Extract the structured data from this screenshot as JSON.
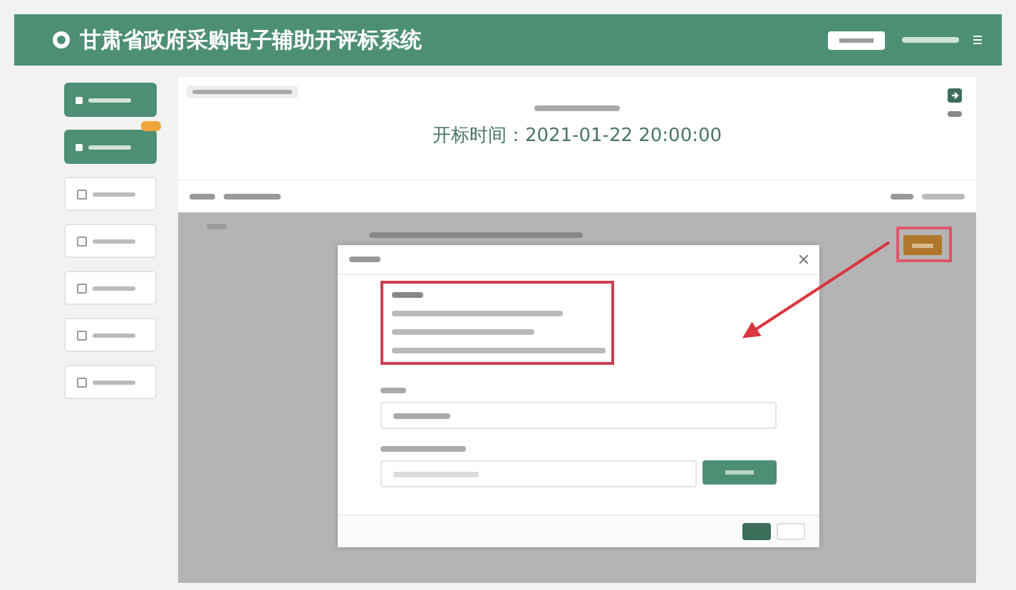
{
  "header": {
    "title": "甘肃省政府采购电子辅助开评标系统"
  },
  "sidebar": {
    "items": [
      {
        "kind": "primary",
        "badge": false
      },
      {
        "kind": "primary",
        "badge": true
      },
      {
        "kind": "outline",
        "badge": false
      },
      {
        "kind": "outline",
        "badge": false
      },
      {
        "kind": "outline",
        "badge": false
      },
      {
        "kind": "outline",
        "badge": false
      },
      {
        "kind": "outline",
        "badge": false
      }
    ]
  },
  "main": {
    "open_time": "开标时间：2021-01-22 20:00:00"
  }
}
